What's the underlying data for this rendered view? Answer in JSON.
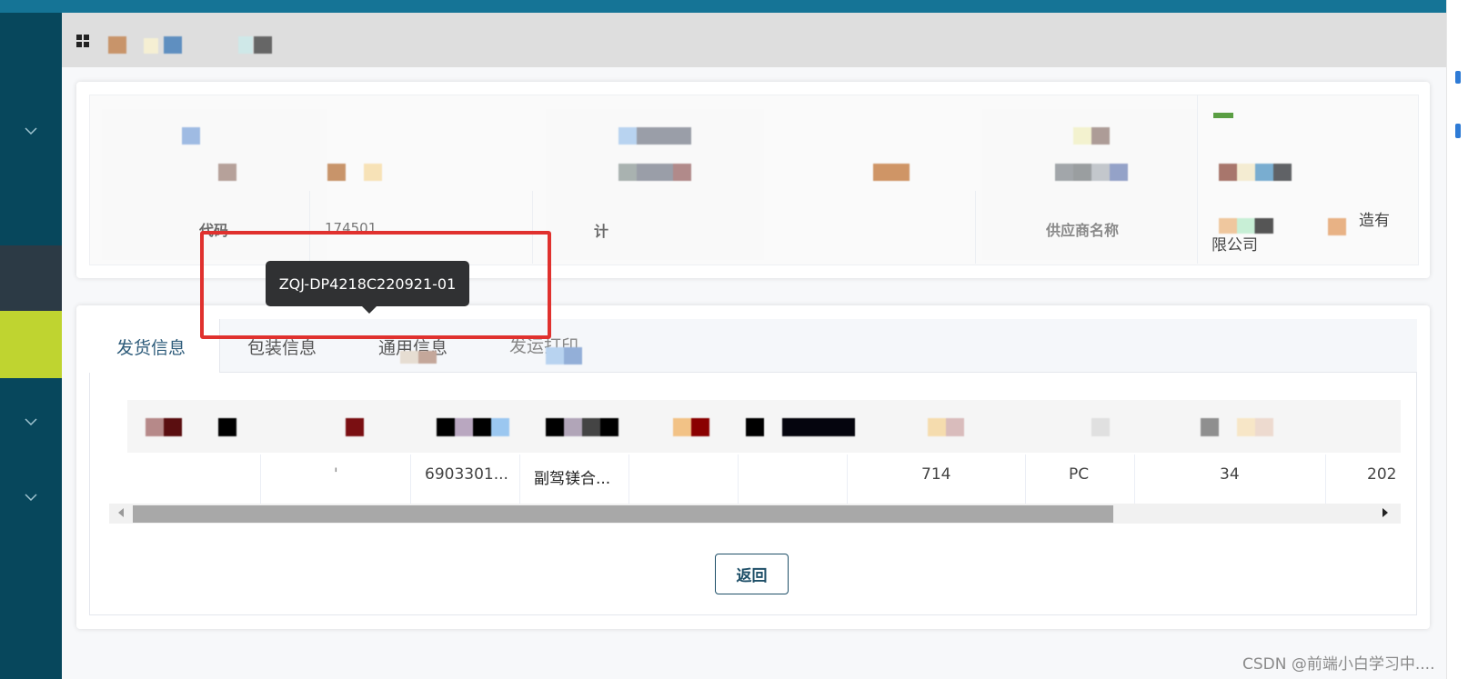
{
  "info": {
    "label_code": "代码",
    "value_code": "174501",
    "label_plan": "计",
    "label_supplier": "供应商名称",
    "value_supplier_line1": "造有",
    "value_supplier_line2": "限公司"
  },
  "tooltip": {
    "text": "ZQJ-DP4218C220921-01"
  },
  "tabs": [
    {
      "label": "发货信息",
      "active": true
    },
    {
      "label": "包装信息",
      "active": false
    },
    {
      "label": "通用信息",
      "active": false
    },
    {
      "label": "发运打印",
      "active": false
    }
  ],
  "table": {
    "row": [
      "",
      "'",
      "6903301...",
      "副驾镁合...",
      "",
      "",
      "714",
      "PC",
      "34",
      "202"
    ]
  },
  "actions": {
    "back_label": "返回"
  },
  "watermark": "CSDN @前端小白学习中...."
}
